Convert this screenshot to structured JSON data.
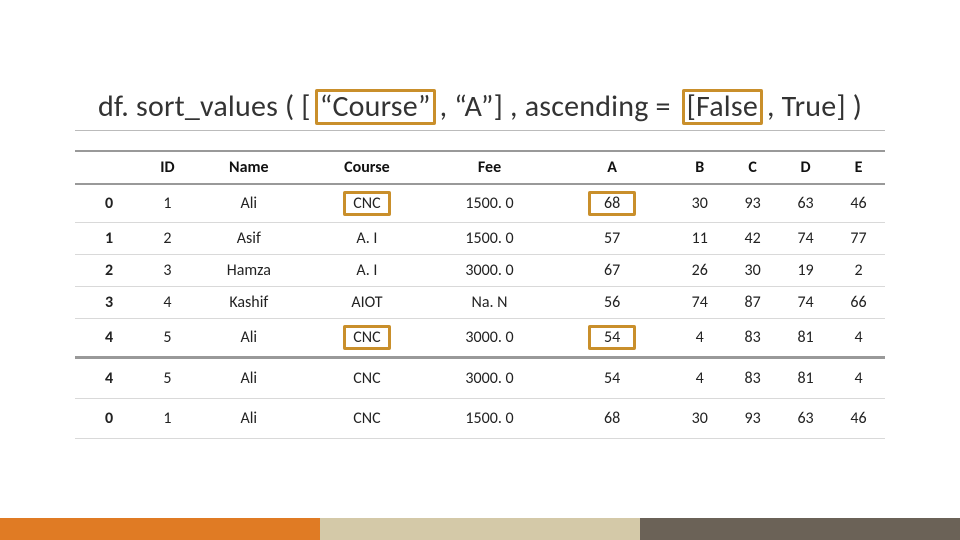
{
  "title": {
    "parts": [
      {
        "text": "df. sort_values ( [",
        "hl": false
      },
      {
        "text": "“Course”",
        "hl": true
      },
      {
        "text": ", “A”] , ascending = ",
        "hl": false
      },
      {
        "text": "[False",
        "hl": true
      },
      {
        "text": ", True] )",
        "hl": false
      }
    ]
  },
  "table": {
    "headers": [
      "",
      "ID",
      "Name",
      "Course",
      "Fee",
      "A",
      "B",
      "C",
      "D",
      "E"
    ],
    "rows_block1": [
      {
        "idx": "0",
        "cells": [
          "1",
          "Ali",
          {
            "v": "CNC",
            "box": true
          },
          "1500. 0",
          {
            "v": "68",
            "box": true
          },
          "30",
          "93",
          "63",
          "46"
        ]
      },
      {
        "idx": "1",
        "cells": [
          "2",
          "Asif",
          "A. I",
          "1500. 0",
          "57",
          "11",
          "42",
          "74",
          "77"
        ]
      },
      {
        "idx": "2",
        "cells": [
          "3",
          "Hamza",
          "A. I",
          "3000. 0",
          "67",
          "26",
          "30",
          "19",
          "2"
        ]
      },
      {
        "idx": "3",
        "cells": [
          "4",
          "Kashif",
          "AIOT",
          "Na. N",
          "56",
          "74",
          "87",
          "74",
          "66"
        ]
      },
      {
        "idx": "4",
        "cells": [
          "5",
          "Ali",
          {
            "v": "CNC",
            "box": true
          },
          "3000. 0",
          {
            "v": "54",
            "box": true
          },
          "4",
          "83",
          "81",
          "4"
        ]
      }
    ],
    "rows_block2": [
      {
        "idx": "4",
        "cells": [
          "5",
          "Ali",
          "CNC",
          "3000. 0",
          "54",
          "4",
          "83",
          "81",
          "4"
        ]
      },
      {
        "idx": "0",
        "cells": [
          "1",
          "Ali",
          "CNC",
          "1500. 0",
          "68",
          "30",
          "93",
          "63",
          "46"
        ]
      }
    ]
  }
}
